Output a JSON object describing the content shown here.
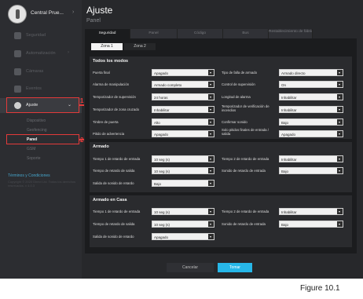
{
  "sidebar": {
    "brand": "Central Prue...",
    "items": [
      {
        "label": "Seguridad"
      },
      {
        "label": "Automatización"
      },
      {
        "label": "Cámaras"
      },
      {
        "label": "Eventos"
      },
      {
        "label": "Ajuste"
      }
    ],
    "subitems": [
      {
        "label": "Dispositivo"
      },
      {
        "label": "Geofencing"
      },
      {
        "label": "Panel"
      },
      {
        "label": "GSM"
      },
      {
        "label": "Soporte"
      }
    ],
    "terms": "Términos y Condiciones",
    "footer": "Copyright © 2020 Direct Ltd. Todos los derechos reservados. v 4.0.3"
  },
  "callouts": [
    "1",
    "2"
  ],
  "header": {
    "title": "Ajuste",
    "subtitle": "Panel"
  },
  "tabs": [
    {
      "label": "Seguridad"
    },
    {
      "label": "Panel"
    },
    {
      "label": "Código"
    },
    {
      "label": "Bus"
    },
    {
      "label": "Restablecimiento de fábrica"
    }
  ],
  "zone_tabs": [
    {
      "label": "Zona 1"
    },
    {
      "label": "Zona 2"
    }
  ],
  "sections": {
    "todos": {
      "title": "Todos los modos",
      "rows": [
        [
          {
            "label": "Puerta final",
            "value": "Apagado"
          },
          {
            "label": "Tipo de falla de armado",
            "value": "Armado directo"
          }
        ],
        [
          {
            "label": "Alarma de manipulación",
            "value": "Armado completo"
          },
          {
            "label": "Control de supervisión",
            "value": "On"
          }
        ],
        [
          {
            "label": "Temporizador de supervisión",
            "value": "24 horas"
          },
          {
            "label": "Longitud de alarma",
            "value": "Inhabilitar"
          }
        ],
        [
          {
            "label": "Temporizador de zona cruzado",
            "value": "Inhabilitar"
          },
          {
            "label": "Temporizador de verificación de incendios",
            "value": "Inhabilitar"
          }
        ],
        [
          {
            "label": "Timbre de puerta",
            "value": "Alto"
          },
          {
            "label": "Confirmar sonido",
            "value": "Bajo"
          }
        ],
        [
          {
            "label": "Pitido de advertencia",
            "value": "Apagado"
          },
          {
            "label": "Solo pitidos finales de entrada / salida",
            "value": "Apagado"
          }
        ]
      ]
    },
    "armado": {
      "title": "Armado",
      "rows": [
        [
          {
            "label": "Tiempo 1 de retardo de entrada",
            "value": "10 seg (s)"
          },
          {
            "label": "Tiempo 2 de retardo de entrada",
            "value": "Inhabilitar"
          }
        ],
        [
          {
            "label": "Tiempo de retardo de salida",
            "value": "10 seg (s)"
          },
          {
            "label": "Sonido de retardo de entrada",
            "value": "Bajo"
          }
        ],
        [
          {
            "label": "Salida de sonido de retardo",
            "value": "Bajo"
          }
        ]
      ]
    },
    "casa": {
      "title": "Armado en Casa",
      "rows": [
        [
          {
            "label": "Tiempo 1 de retardo de entrada",
            "value": "10 seg (s)"
          },
          {
            "label": "Tiempo 2 de retardo de entrada",
            "value": "Inhabilitar"
          }
        ],
        [
          {
            "label": "Tiempo de retardo de salida",
            "value": "10 seg (s)"
          },
          {
            "label": "Sonido de retardo de entrada",
            "value": "Bajo"
          }
        ],
        [
          {
            "label": "Salida de sonido de retardo",
            "value": "Apagado"
          }
        ]
      ]
    }
  },
  "buttons": {
    "cancel": "Cancelar",
    "ok": "Tomar"
  },
  "figure_caption": "Figure  10.1",
  "colors": {
    "accent": "#27b7e8",
    "highlight": "#e33a3a"
  }
}
